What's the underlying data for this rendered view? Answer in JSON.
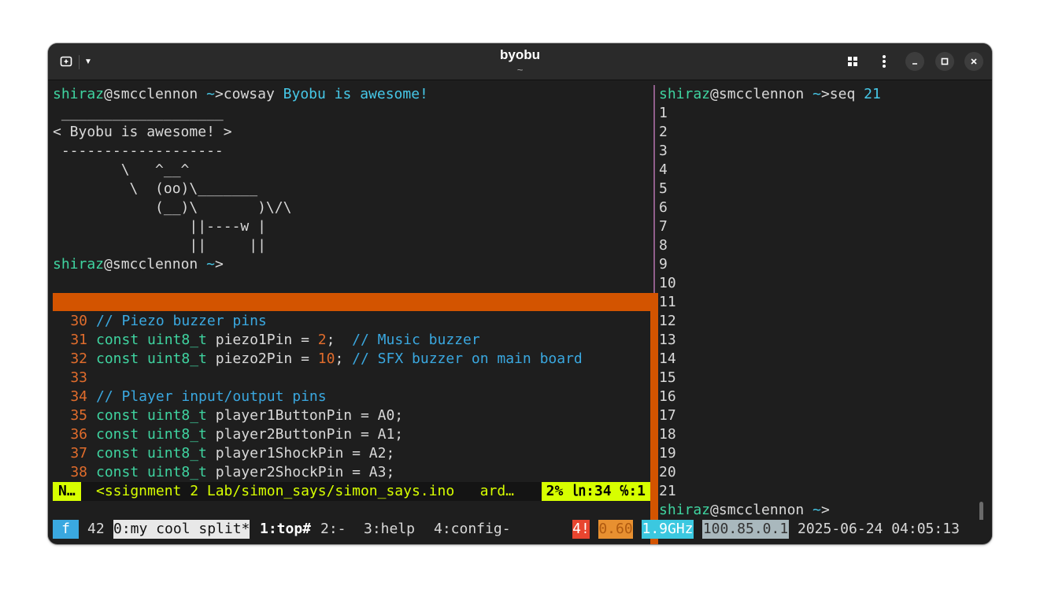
{
  "window": {
    "title": "byobu",
    "subtitle": "~"
  },
  "left_pane": {
    "prompt_user": "shiraz",
    "prompt_at": "@",
    "prompt_host": "smcclennon",
    "prompt_dir": "~",
    "prompt_arrow": ">",
    "command": "cowsay",
    "command_arg": "Byobu is awesome!",
    "cow_lines": [
      " ___________________",
      "< Byobu is awesome! >",
      " -------------------",
      "        \\   ^__^",
      "         \\  (oo)\\_______",
      "            (__)\\       )\\/\\",
      "                ||----w |",
      "                ||     ||"
    ]
  },
  "vim": {
    "lines": [
      {
        "num": "30",
        "segments": [
          {
            "t": "// Piezo buzzer pins",
            "c": "cm"
          }
        ]
      },
      {
        "num": "31",
        "segments": [
          {
            "t": "const uint8_t",
            "c": "kw"
          },
          {
            "t": " piezo1Pin = ",
            "c": ""
          },
          {
            "t": "2",
            "c": "num"
          },
          {
            "t": ";  ",
            "c": ""
          },
          {
            "t": "// Music buzzer",
            "c": "cm"
          }
        ]
      },
      {
        "num": "32",
        "segments": [
          {
            "t": "const uint8_t",
            "c": "kw"
          },
          {
            "t": " piezo2Pin = ",
            "c": ""
          },
          {
            "t": "10",
            "c": "num"
          },
          {
            "t": "; ",
            "c": ""
          },
          {
            "t": "// SFX buzzer on main board",
            "c": "cm"
          }
        ]
      },
      {
        "num": "33",
        "segments": []
      },
      {
        "num": "34",
        "segments": [
          {
            "t": "// Player input/output pins",
            "c": "cm"
          }
        ]
      },
      {
        "num": "35",
        "segments": [
          {
            "t": "const uint8_t",
            "c": "kw"
          },
          {
            "t": " player1ButtonPin = A0;",
            "c": ""
          }
        ]
      },
      {
        "num": "36",
        "segments": [
          {
            "t": "const uint8_t",
            "c": "kw"
          },
          {
            "t": " player2ButtonPin = A1;",
            "c": ""
          }
        ]
      },
      {
        "num": "37",
        "segments": [
          {
            "t": "const uint8_t",
            "c": "kw"
          },
          {
            "t": " player1ShockPin = A2;",
            "c": ""
          }
        ]
      },
      {
        "num": "38",
        "segments": [
          {
            "t": "const uint8_t",
            "c": "kw"
          },
          {
            "t": " player2ShockPin = A3;",
            "c": ""
          }
        ]
      }
    ],
    "status": {
      "mode": "N…",
      "file": "<ssignment 2 Lab/simon_says/simon_says.ino   ard…",
      "position": "2% ㏑:34 ℅:1"
    }
  },
  "right_pane": {
    "prompt_user": "shiraz",
    "prompt_at": "@",
    "prompt_host": "smcclennon",
    "prompt_dir": "~",
    "prompt_arrow": ">",
    "command": "seq",
    "command_arg": "21",
    "output": [
      "1",
      "2",
      "3",
      "4",
      "5",
      "6",
      "7",
      "8",
      "9",
      "10",
      "11",
      "12",
      "13",
      "14",
      "15",
      "16",
      "17",
      "18",
      "19",
      "20",
      "21"
    ]
  },
  "statusbar": {
    "logo": " f ",
    "updates": "42",
    "windows": [
      {
        "label": "0:my cool split*",
        "active": true
      },
      {
        "label": "1:top#",
        "active": false
      },
      {
        "label": "2:-",
        "active": false
      },
      {
        "label": "3:help",
        "active": false
      },
      {
        "label": "4:config-",
        "active": false
      }
    ],
    "alert": "4!",
    "load": "0.60",
    "cpu_freq": "1.9GHz",
    "ip": "100.85.0.1",
    "datetime": "2025-06-24 04:05:13"
  },
  "colors": {
    "accent_orange": "#d35400",
    "prompt_green": "#3fd4a0",
    "cyan": "#46c8e8",
    "vim_status": "#d7ff00",
    "pane_separator": "#8f5e8a"
  },
  "icons": {
    "new_tab": "new-tab-icon",
    "menu_dropdown": "chevron-down-icon",
    "grid": "grid-icon",
    "kebab": "kebab-menu-icon",
    "minimize": "minimize-icon",
    "maximize": "maximize-icon",
    "close": "close-icon"
  }
}
